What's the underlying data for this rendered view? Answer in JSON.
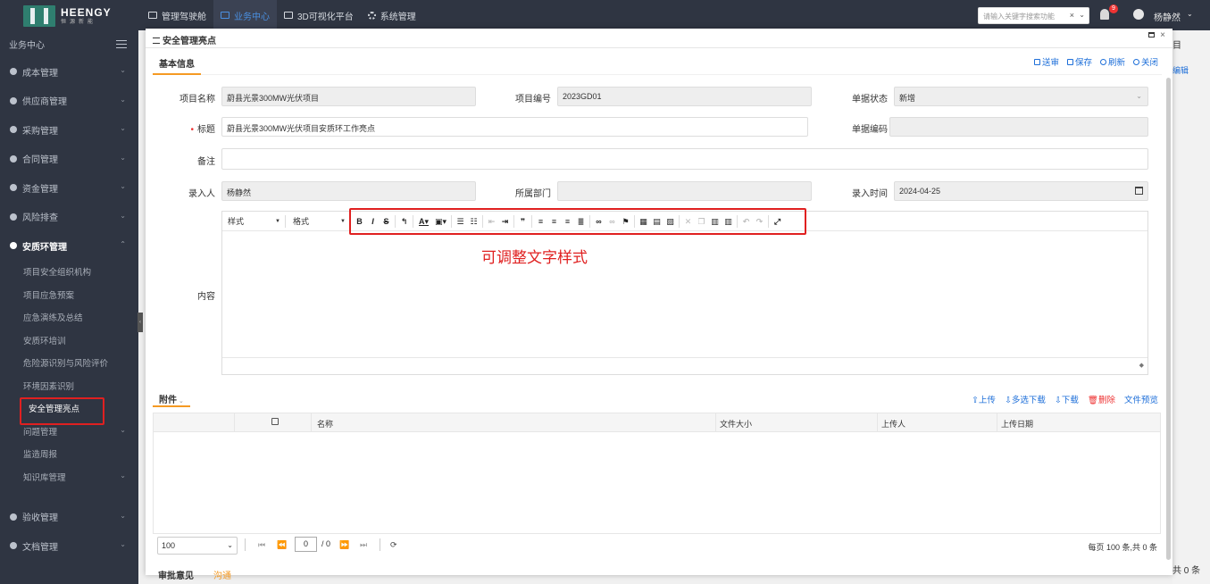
{
  "header": {
    "logo_en": "HEENGY",
    "logo_cn": "恒源新能",
    "nav": [
      {
        "label": "管理驾驶舱",
        "icon": "monitor-icon"
      },
      {
        "label": "业务中心",
        "icon": "window-icon",
        "active": true
      },
      {
        "label": "3D可视化平台",
        "icon": "monitor-icon"
      },
      {
        "label": "系统管理",
        "icon": "gear-icon"
      }
    ],
    "search_placeholder": "请输入关键字搜索功能",
    "search_clear": "×",
    "notification_count": "9",
    "user_name": "杨静然"
  },
  "sidebar": {
    "title": "业务中心",
    "items": [
      {
        "label": "成本管理",
        "icon": "coin-icon"
      },
      {
        "label": "供应商管理",
        "icon": "user-icon"
      },
      {
        "label": "采购管理",
        "icon": "scale-icon"
      },
      {
        "label": "合同管理",
        "icon": "card-icon"
      },
      {
        "label": "资金管理",
        "icon": "money-icon"
      },
      {
        "label": "风险排查",
        "icon": "calendar-icon"
      }
    ],
    "open_group": {
      "label": "安质环管理",
      "icon": "shield-icon"
    },
    "sub_items": [
      "项目安全组织机构",
      "项目应急预案",
      "应急演练及总结",
      "安质环培训",
      "危险源识别与风险评价",
      "环境因素识别",
      "安全管理亮点",
      "问题管理",
      "监造周报",
      "知识库管理"
    ],
    "after_items": [
      {
        "label": "验收管理",
        "icon": "eye-icon"
      },
      {
        "label": "文档管理",
        "icon": "doc-icon"
      }
    ]
  },
  "background": {
    "r1": "目",
    "r2": "编辑",
    "r3": "共 0 条"
  },
  "modal": {
    "title": "安全管理亮点",
    "tab": "基本信息",
    "actions": [
      "送审",
      "保存",
      "刷新",
      "关闭"
    ],
    "form": {
      "project_name_label": "项目名称",
      "project_name": "蔚县光景300MW光伏项目",
      "project_code_label": "项目编号",
      "project_code": "2023GD01",
      "status_label": "单据状态",
      "status": "新增",
      "title_label": "标题",
      "title": "蔚县光景300MW光伏项目安质环工作亮点",
      "doc_code_label": "单据编码",
      "doc_code": "",
      "remark_label": "备注",
      "remark": "",
      "entered_by_label": "录入人",
      "entered_by": "杨静然",
      "dept_label": "所属部门",
      "dept": "",
      "entry_time_label": "录入时间",
      "entry_time": "2024-04-25",
      "content_label": "内容"
    },
    "editor": {
      "style_select": "样式",
      "format_select": "格式"
    },
    "annotation": "可调整文字样式",
    "attachments": {
      "tab": "附件",
      "actions": [
        "上传",
        "多选下载",
        "下载",
        "删除",
        "文件预览"
      ],
      "columns": [
        "名称",
        "文件大小",
        "上传人",
        "上传日期"
      ]
    },
    "pager": {
      "page_size": "100",
      "page": "0",
      "total_pages": "/ 0",
      "info": "每页 100 条,共 0 条"
    },
    "bottom": {
      "tab": "审批意见",
      "tab2": "沟通"
    }
  }
}
